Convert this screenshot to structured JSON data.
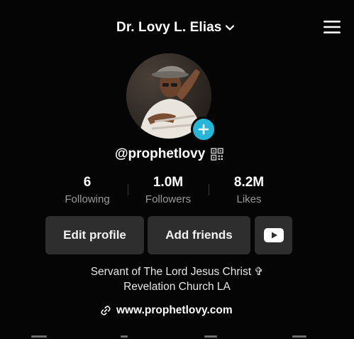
{
  "header": {
    "account_name": "Dr. Lovy L. Elias",
    "icons": {
      "switcher": "chevron-down-icon",
      "menu": "hamburger-menu-icon"
    }
  },
  "profile": {
    "username": "@prophetlovy",
    "add_button_icon": "plus-icon",
    "qr_icon": "qr-code-icon"
  },
  "stats": [
    {
      "value": "6",
      "label": "Following"
    },
    {
      "value": "1.0M",
      "label": "Followers"
    },
    {
      "value": "8.2M",
      "label": "Likes"
    }
  ],
  "actions": {
    "edit_profile": "Edit profile",
    "add_friends": "Add friends",
    "youtube_icon": "youtube-icon"
  },
  "bio": {
    "line1": "Servant of The Lord Jesus Christ ✞",
    "line2": "Revelation Church LA"
  },
  "link": {
    "url": "www.prophetlovy.com",
    "icon": "link-icon"
  },
  "colors": {
    "background": "#050505",
    "button_bg": "#2e2e2e",
    "accent": "#25b6d9",
    "muted_text": "#9a9a9a"
  }
}
